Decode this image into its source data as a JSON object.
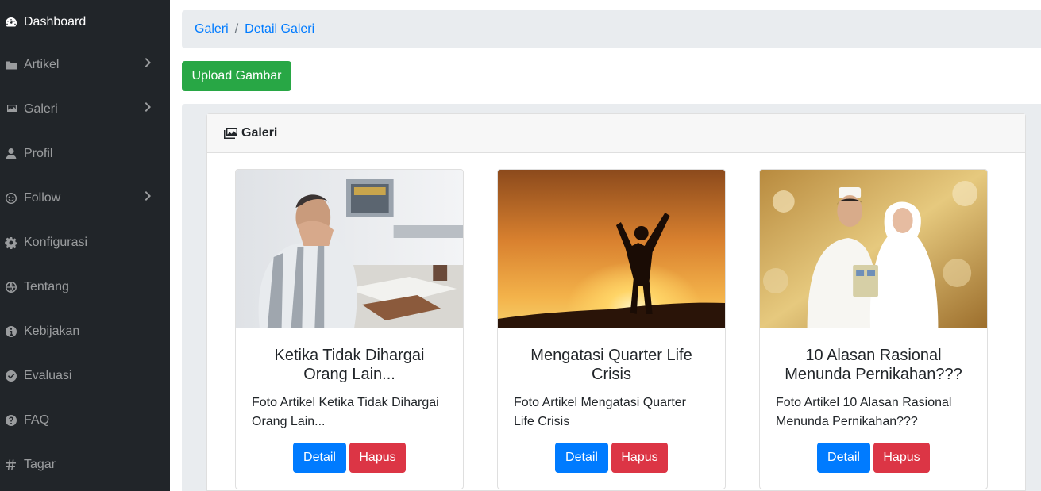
{
  "sidebar": {
    "items": [
      {
        "label": "Dashboard",
        "icon": "tachometer-icon",
        "has_submenu": false,
        "active": true
      },
      {
        "label": "Artikel",
        "icon": "folder-icon",
        "has_submenu": true
      },
      {
        "label": "Galeri",
        "icon": "images-icon",
        "has_submenu": true
      },
      {
        "label": "Profil",
        "icon": "user-icon",
        "has_submenu": false
      },
      {
        "label": "Follow",
        "icon": "smile-icon",
        "has_submenu": true
      },
      {
        "label": "Konfigurasi",
        "icon": "cog-icon",
        "has_submenu": false
      },
      {
        "label": "Tentang",
        "icon": "globe-icon",
        "has_submenu": false
      },
      {
        "label": "Kebijakan",
        "icon": "info-circle-icon",
        "has_submenu": false
      },
      {
        "label": "Evaluasi",
        "icon": "check-circle-icon",
        "has_submenu": false
      },
      {
        "label": "FAQ",
        "icon": "question-circle-icon",
        "has_submenu": false
      },
      {
        "label": "Tagar",
        "icon": "hashtag-icon",
        "has_submenu": false
      }
    ]
  },
  "breadcrumb": {
    "items": [
      "Galeri",
      "Detail Galeri"
    ],
    "separator": "/"
  },
  "upload_button": "Upload Gambar",
  "panel": {
    "title": "Galeri",
    "icon": "images-icon"
  },
  "gallery": [
    {
      "title": "Ketika Tidak Dihargai Orang Lain...",
      "text": "Foto Artikel Ketika Tidak Dihargai Orang Lain...",
      "image": "stressed-man-at-desk-photo",
      "detail_label": "Detail",
      "delete_label": "Hapus"
    },
    {
      "title": "Mengatasi Quarter Life Crisis",
      "text": "Foto Artikel Mengatasi Quarter Life Crisis",
      "image": "silhouette-sunset-photo",
      "detail_label": "Detail",
      "delete_label": "Hapus"
    },
    {
      "title": "10 Alasan Rasional Menunda Pernikahan???",
      "text": "Foto Artikel 10 Alasan Rasional Menunda Pernikahan???",
      "image": "wedding-couple-photo",
      "detail_label": "Detail",
      "delete_label": "Hapus"
    }
  ],
  "colors": {
    "sidebar_bg": "#212529",
    "primary": "#007bff",
    "success": "#28a745",
    "danger": "#dc3545",
    "breadcrumb_bg": "#e9ecef"
  }
}
